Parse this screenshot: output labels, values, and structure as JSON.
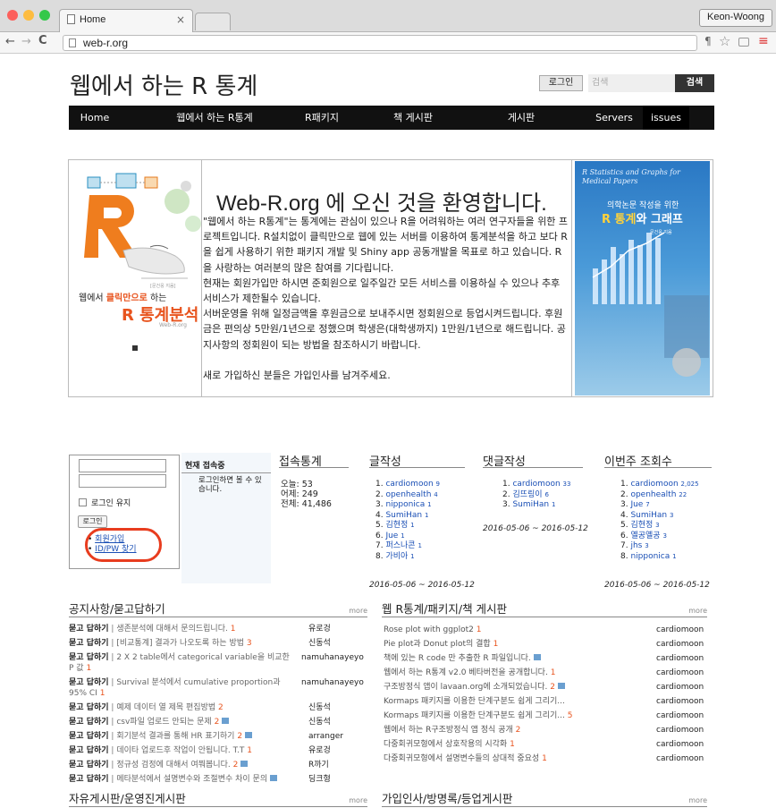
{
  "browser": {
    "tab_title": "Home",
    "tab_close": "×",
    "profile": "Keon-Woong",
    "url": "web-r.org"
  },
  "header": {
    "site_title": "웹에서 하는 R 통계",
    "login_button": "로그인",
    "search_placeholder": "검색",
    "search_button": "검색"
  },
  "nav": [
    "Home",
    "웹에서 하는 R통계",
    "R패키지",
    "책 게시판",
    "게시판",
    "Servers",
    "issues"
  ],
  "welcome": {
    "title": "Web-R.org 에 오신 것을 환영합니다.",
    "paragraphs": [
      "\"웹에서 하는 R통계\"는 통계에는 관심이 있으나 R을 어려워하는 여러 연구자들을 위한 프로젝트입니다. R설치없이 클릭만으로 웹에 있는 서버를 이용하여 통계분석을 하고 보다 R을 쉽게 사용하기 위한 패키지 개발 및 Shiny app 공동개발을 목표로 하고 있습니다.  R을 사랑하는 여러분의 많은 참여를 기다립니다.",
      "현재는 회원가입만 하시면 준회원으로 일주일간 모든 서비스를 이용하실 수 있으나 추후 서비스가 제한될수 있습니다.",
      "서버운영을 위해 일정금액을 후원금으로 보내주시면 정회원으로 등업시켜드립니다. 후원금은 편의상 5만원/1년으로 정했으며 학생은(대학생까지) 1만원/1년으로 해드립니다. 공지사항의 정회원이 되는 방법을 참조하시기 바랍니다.",
      "",
      "새로 가입하신 분들은 가입인사를 남겨주세요."
    ]
  },
  "book1": {
    "caption_prefix": "웹에서",
    "caption_highlight": "클릭만으로",
    "caption_suffix": "하는",
    "title": "R 통계분석",
    "sub": "Web-R.org",
    "author": "[문건웅 지음]"
  },
  "book2": {
    "en_title": "R Statistics and Graphs for Medical Papers",
    "kr_sub": "의학논문 작성을 위한",
    "kr_title_a": "R 통계",
    "kr_title_b": "와 그래프",
    "author": "문건웅 지음"
  },
  "login": {
    "keep_login": "로그인 유지",
    "login_button": "로그인",
    "links": [
      "회원가입",
      "ID/PW 찾기"
    ]
  },
  "current_users": {
    "title": "현재 접속중",
    "text": "로그인하면 볼 수 있습니다."
  },
  "visits": {
    "title": "접속통계",
    "today": "오늘: 53",
    "yesterday": "어제: 249",
    "total": "전체: 41,486"
  },
  "posts": {
    "title": "글작성",
    "items": [
      {
        "name": "cardiomoon",
        "n": "9"
      },
      {
        "name": "openhealth",
        "n": "4"
      },
      {
        "name": "nipponica",
        "n": "1"
      },
      {
        "name": "SumiHan",
        "n": "1"
      },
      {
        "name": "김현정",
        "n": "1"
      },
      {
        "name": "Jue",
        "n": "1"
      },
      {
        "name": "퍼스나콘",
        "n": "1"
      },
      {
        "name": "가비아",
        "n": "1"
      }
    ],
    "period": "2016-05-06 ~ 2016-05-12"
  },
  "comments": {
    "title": "댓글작성",
    "items": [
      {
        "name": "cardiomoon",
        "n": "33"
      },
      {
        "name": "김뜨링이",
        "n": "6"
      },
      {
        "name": "SumiHan",
        "n": "1"
      }
    ],
    "period": "2016-05-06 ~ 2016-05-12"
  },
  "views": {
    "title": "이번주 조회수",
    "items": [
      {
        "name": "cardiomoon",
        "n": "2,025"
      },
      {
        "name": "openhealth",
        "n": "22"
      },
      {
        "name": "Jue",
        "n": "7"
      },
      {
        "name": "SumiHan",
        "n": "3"
      },
      {
        "name": "김현정",
        "n": "3"
      },
      {
        "name": "옐공옐공",
        "n": "3"
      },
      {
        "name": "jhs",
        "n": "3"
      },
      {
        "name": "nipponica",
        "n": "1"
      }
    ],
    "period": "2016-05-06 ~ 2016-05-12"
  },
  "notice": {
    "title": "공지사항/묻고답하기",
    "more": "more",
    "rows": [
      {
        "cat": "묻고 답하기",
        "text": "생존분석에 대해서 문의드립니다.",
        "cnt": "1",
        "author": "유로겅"
      },
      {
        "cat": "묻고 답하기",
        "text": "[비교통계] 결과가 나오도록 하는 방법",
        "cnt": "3",
        "author": "신동석"
      },
      {
        "cat": "묻고 답하기",
        "text": "2 X 2 table에서 categorical variable을 비교한 P 값",
        "cnt": "1",
        "author": "namuhanayeyo"
      },
      {
        "cat": "묻고 답하기",
        "text": "Survival 분석에서 cumulative proportion과 95% CI",
        "cnt": "1",
        "author": "namuhanayeyo"
      },
      {
        "cat": "묻고 답하기",
        "text": "예제 데이터 열 제목 편집방법",
        "cnt": "2",
        "author": "신동석"
      },
      {
        "cat": "묻고 답하기",
        "text": "csv파일 업로드 안되는 문제",
        "cnt": "2",
        "author": "신동석"
      },
      {
        "cat": "묻고 답하기",
        "text": "회기분석 결과를 통해 HR 표기하기",
        "cnt": "2",
        "author": "arranger"
      },
      {
        "cat": "묻고 답하기",
        "text": "데이타 업로드후 작업이 안됩니다. T.T",
        "cnt": "1",
        "author": "유로겅"
      },
      {
        "cat": "묻고 답하기",
        "text": "정규성 검정에 대해서 여쭤봅니다.",
        "cnt": "2",
        "author": "R까기"
      },
      {
        "cat": "묻고 답하기",
        "text": "메타분석에서 설명변수와 조절변수 차이 문의",
        "cnt": "",
        "author": "딩크형"
      }
    ]
  },
  "books_board": {
    "title": "웹 R통계/패키지/책 게시판",
    "more": "more",
    "rows": [
      {
        "text": "Rose plot with ggplot2",
        "cnt": "1",
        "author": "cardiomoon"
      },
      {
        "text": "Pie plot과 Donut plot의 결합",
        "cnt": "1",
        "author": "cardiomoon"
      },
      {
        "text": "책에 있는 R code 만 추출한 R 파일입니다.",
        "cnt": "",
        "author": "cardiomoon"
      },
      {
        "text": "웹에서 하는 R통계 v2.0 베타버전을 공개합니다.",
        "cnt": "1",
        "author": "cardiomoon"
      },
      {
        "text": "구조방정식 앱이 lavaan.org에 소개되었습니다.",
        "cnt": "2",
        "author": "cardiomoon"
      },
      {
        "text": "Kormaps 패키지를 이용한 단계구분도 쉽게 그리기...",
        "cnt": "",
        "author": "cardiomoon"
      },
      {
        "text": "Kormaps 패키지를 이용한 단계구분도 쉽게 그리기...",
        "cnt": "5",
        "author": "cardiomoon"
      },
      {
        "text": "웹에서 하는 R구조방정식 앱 정식 공개",
        "cnt": "2",
        "author": "cardiomoon"
      },
      {
        "text": "다중회귀모형에서 상호작용의 시각화",
        "cnt": "1",
        "author": "cardiomoon"
      },
      {
        "text": "다중회귀모형에서 설명변수들의 상대적 중요성",
        "cnt": "1",
        "author": "cardiomoon"
      }
    ]
  },
  "free_board": {
    "title": "자유게시판/운영진게시판",
    "more": "more"
  },
  "guest_board": {
    "title": "가입인사/방명록/등업게시판",
    "more": "more"
  },
  "colors": {
    "nav_bg": "#111111",
    "accent": "#e83c1e",
    "link": "#1a4fb5"
  }
}
